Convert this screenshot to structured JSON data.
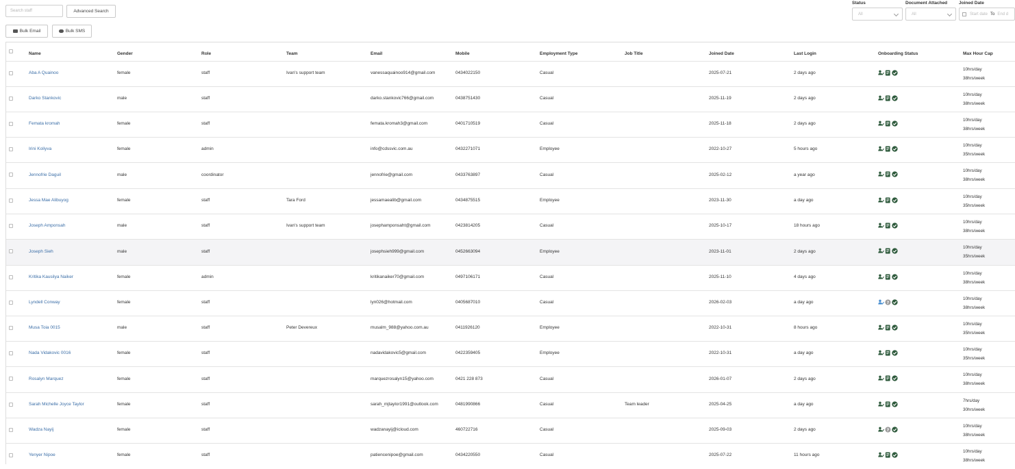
{
  "search": {
    "placeholder": "Search staff"
  },
  "toolbar": {
    "advanced_search": "Advanced Search",
    "bulk_email": "Bulk Email",
    "bulk_sms": "Bulk SMS"
  },
  "filters": {
    "status_label": "Status",
    "status_value": "All",
    "document_label": "Document Attached",
    "document_value": "All",
    "joined_label": "Joined Date",
    "start_placeholder": "Start date",
    "to": "To",
    "end_placeholder": "End d"
  },
  "columns": [
    "Name",
    "Gender",
    "Role",
    "Team",
    "Email",
    "Mobile",
    "Employment Type",
    "Job Title",
    "Joined Date",
    "Last Login",
    "Onboarding Status",
    "Max Hour Cap"
  ],
  "colors": {
    "link": "#3b6ea7",
    "onboarding_dark": "#2e5a3c",
    "onboarding_blue": "#4a8fd0",
    "unknown_gray": "#9a9a9a"
  },
  "rows": [
    {
      "name": "Aba A Quainoo",
      "gender": "female",
      "role": "staff",
      "team": "Ivan's support team",
      "email": "vanessaquainoo914@gmail.com",
      "mobile": "0434022150",
      "type": "Casual",
      "job": "",
      "joined": "2025-07-21",
      "login": "2 days ago",
      "cap1": "10hrs/day",
      "cap2": "38hrs/week",
      "person": "dark",
      "doc": "doc"
    },
    {
      "name": "Darko Stankovic",
      "gender": "male",
      "role": "staff",
      "team": "",
      "email": "darko.stankovic766@gmail.com",
      "mobile": "0438751430",
      "type": "Casual",
      "job": "",
      "joined": "2025-11-19",
      "login": "2 days ago",
      "cap1": "10hrs/day",
      "cap2": "38hrs/week",
      "person": "dark",
      "doc": "doc"
    },
    {
      "name": "Femata kromah",
      "gender": "female",
      "role": "staff",
      "team": "",
      "email": "femata.kromah3@gmail.com",
      "mobile": "0401710519",
      "type": "Casual",
      "job": "",
      "joined": "2025-11-18",
      "login": "2 days ago",
      "cap1": "10hrs/day",
      "cap2": "38hrs/week",
      "person": "dark",
      "doc": "doc"
    },
    {
      "name": "Irini Koliyva",
      "gender": "female",
      "role": "admin",
      "team": "",
      "email": "info@cdssvic.com.au",
      "mobile": "0432271071",
      "type": "Employee",
      "job": "",
      "joined": "2022-10-27",
      "login": "5 hours ago",
      "cap1": "10hrs/day",
      "cap2": "35hrs/week",
      "person": "dark",
      "doc": "doc"
    },
    {
      "name": "Jennofrie Daguil",
      "gender": "male",
      "role": "coordinator",
      "team": "",
      "email": "jennofrie@gmail.com",
      "mobile": "0433763897",
      "type": "Casual",
      "job": "",
      "joined": "2025-02-12",
      "login": "a year ago",
      "cap1": "10hrs/day",
      "cap2": "38hrs/week",
      "person": "dark",
      "doc": "doc"
    },
    {
      "name": "Jessa Mae Alibuyog",
      "gender": "female",
      "role": "staff",
      "team": "Tara Ford",
      "email": "jessamaealib@gmail.com",
      "mobile": "0434875515",
      "type": "Employee",
      "job": "",
      "joined": "2023-11-30",
      "login": "a day ago",
      "cap1": "10hrs/day",
      "cap2": "35hrs/week",
      "person": "dark",
      "doc": "doc"
    },
    {
      "name": "Joseph Amponsah",
      "gender": "male",
      "role": "staff",
      "team": "Ivan's support team",
      "email": "josephamponsaht@gmail.com",
      "mobile": "0423814205",
      "type": "Casual",
      "job": "",
      "joined": "2025-10-17",
      "login": "18 hours ago",
      "cap1": "10hrs/day",
      "cap2": "38hrs/week",
      "person": "dark",
      "doc": "doc"
    },
    {
      "name": "Joseph Sieh",
      "gender": "male",
      "role": "staff",
      "team": "",
      "email": "josephsieh999@gmail.com",
      "mobile": "0452663094",
      "type": "Employee",
      "job": "",
      "joined": "2023-11-01",
      "login": "2 days ago",
      "cap1": "10hrs/day",
      "cap2": "35hrs/week",
      "person": "dark",
      "doc": "doc"
    },
    {
      "name": "Kritika Kausilya Naiker",
      "gender": "female",
      "role": "admin",
      "team": "",
      "email": "kritikanaiker70@gmail.com",
      "mobile": "0497106171",
      "type": "Casual",
      "job": "",
      "joined": "2025-11-10",
      "login": "4 days ago",
      "cap1": "10hrs/day",
      "cap2": "38hrs/week",
      "person": "dark",
      "doc": "doc"
    },
    {
      "name": "Lyndell Conway",
      "gender": "female",
      "role": "staff",
      "team": "",
      "email": "lyn026@hotmail.com",
      "mobile": "0405687010",
      "type": "Casual",
      "job": "",
      "joined": "2026-02-03",
      "login": "a day ago",
      "cap1": "10hrs/day",
      "cap2": "38hrs/week",
      "person": "blue",
      "doc": "unknown"
    },
    {
      "name": "Musa Toia 0015",
      "gender": "male",
      "role": "staff",
      "team": "Peter Devereux",
      "email": "musalm_988@yahoo.com.au",
      "mobile": "0411926120",
      "type": "Employee",
      "job": "",
      "joined": "2022-10-31",
      "login": "8 hours ago",
      "cap1": "10hrs/day",
      "cap2": "35hrs/week",
      "person": "dark",
      "doc": "doc"
    },
    {
      "name": "Nada Vidakovic 0016",
      "gender": "female",
      "role": "staff",
      "team": "",
      "email": "nadavidakovic5@gmail.com",
      "mobile": "0422359405",
      "type": "Employee",
      "job": "",
      "joined": "2022-10-31",
      "login": "a day ago",
      "cap1": "10hrs/day",
      "cap2": "35hrs/week",
      "person": "dark",
      "doc": "doc"
    },
    {
      "name": "Rosalyn Marquez",
      "gender": "female",
      "role": "staff",
      "team": "",
      "email": "marquezrosalyn15@yahoo.com",
      "mobile": "0421 228 873",
      "type": "Casual",
      "job": "",
      "joined": "2026-01-07",
      "login": "2 days ago",
      "cap1": "10hrs/day",
      "cap2": "38hrs/week",
      "person": "dark",
      "doc": "doc"
    },
    {
      "name": "Sarah Michelle Joyce Taylor",
      "gender": "female",
      "role": "staff",
      "team": "",
      "email": "sarah_mjtaylor1991@outlook.com",
      "mobile": "0481990866",
      "type": "Casual",
      "job": "Team leader",
      "joined": "2025-04-25",
      "login": "a day ago",
      "cap1": "7hrs/day",
      "cap2": "30hrs/week",
      "person": "dark",
      "doc": "doc"
    },
    {
      "name": "Wadza Nayij",
      "gender": "female",
      "role": "staff",
      "team": "",
      "email": "wadzanayij@icloud.com",
      "mobile": "460722716",
      "type": "Casual",
      "job": "",
      "joined": "2025-09-03",
      "login": "2 days ago",
      "cap1": "10hrs/day",
      "cap2": "38hrs/week",
      "person": "dark",
      "doc": "unknown"
    },
    {
      "name": "Yenyer Nipoe",
      "gender": "female",
      "role": "staff",
      "team": "",
      "email": "patiencenipoe@gmail.com",
      "mobile": "0434220550",
      "type": "Casual",
      "job": "",
      "joined": "2025-07-22",
      "login": "11 hours ago",
      "cap1": "10hrs/day",
      "cap2": "38hrs/week",
      "person": "dark",
      "doc": "doc"
    }
  ]
}
